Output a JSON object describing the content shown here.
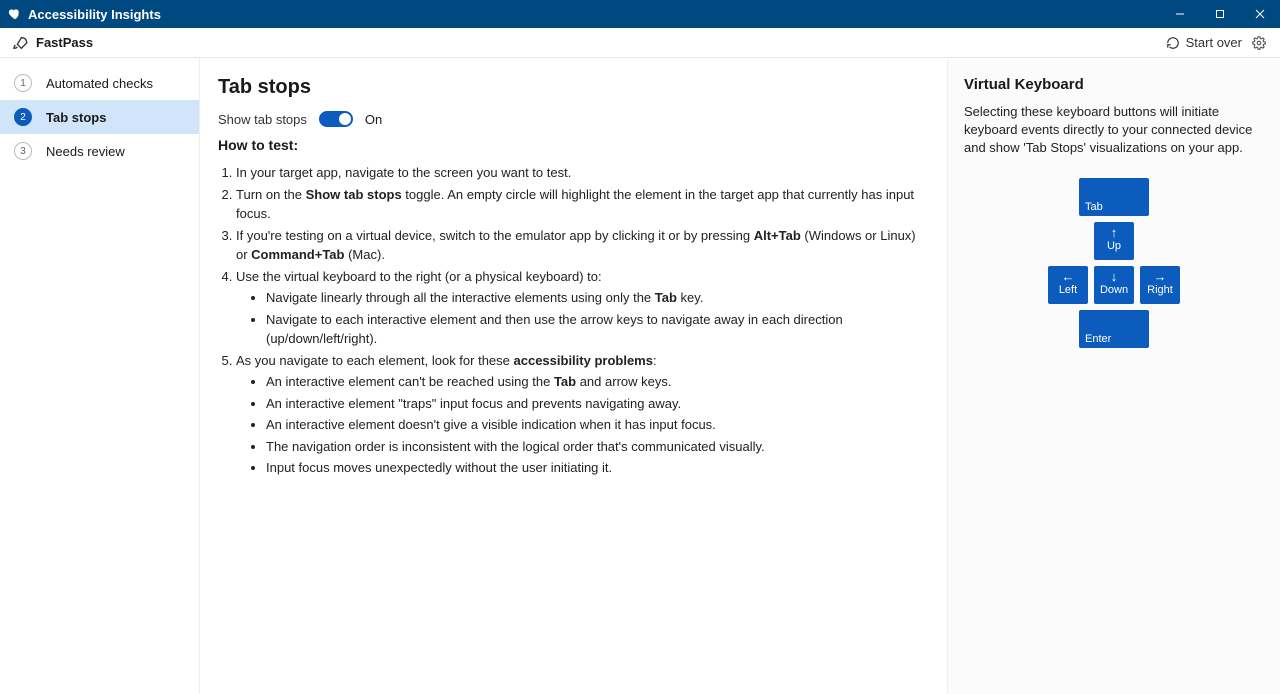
{
  "titlebar": {
    "app_title": "Accessibility Insights"
  },
  "subheader": {
    "section": "FastPass",
    "start_over": "Start over"
  },
  "sidebar": {
    "items": [
      {
        "num": "1",
        "label": "Automated checks"
      },
      {
        "num": "2",
        "label": "Tab stops"
      },
      {
        "num": "3",
        "label": "Needs review"
      }
    ],
    "active_index": 1
  },
  "main": {
    "title": "Tab stops",
    "toggle_label": "Show tab stops",
    "toggle_state": "On",
    "howto_title": "How to test:",
    "step1": "In your target app, navigate to the screen you want to test.",
    "step2a": "Turn on the ",
    "step2b": "Show tab stops",
    "step2c": " toggle. An empty circle will highlight the element in the target app that currently has input focus.",
    "step3a": "If you're testing on a virtual device, switch to the emulator app by clicking it or by pressing ",
    "step3b": "Alt+Tab",
    "step3c": " (Windows or Linux) or ",
    "step3d": "Command+Tab",
    "step3e": " (Mac).",
    "step4": "Use the virtual keyboard to the right (or a physical keyboard) to:",
    "step4_b1a": "Navigate linearly through all the interactive elements using only the ",
    "step4_b1b": "Tab",
    "step4_b1c": " key.",
    "step4_b2": "Navigate to each interactive element and then use the arrow keys to navigate away in each direction (up/down/left/right).",
    "step5a": "As you navigate to each element, look for these ",
    "step5b": "accessibility problems",
    "step5c": ":",
    "step5_bullets": [
      "An interactive element can't be reached using the Tab and arrow keys.",
      "An interactive element \"traps\" input focus and prevents navigating away.",
      "An interactive element doesn't give a visible indication when it has input focus.",
      "The navigation order is inconsistent with the logical order that's communicated visually.",
      "Input focus moves unexpectedly without the user initiating it."
    ],
    "tab_bold": "Tab"
  },
  "right": {
    "title": "Virtual Keyboard",
    "desc": "Selecting these keyboard buttons will initiate keyboard events directly to your connected device and show 'Tab Stops' visualizations on your app.",
    "keys": {
      "tab": "Tab",
      "up": "Up",
      "left": "Left",
      "down": "Down",
      "right": "Right",
      "enter": "Enter"
    }
  }
}
